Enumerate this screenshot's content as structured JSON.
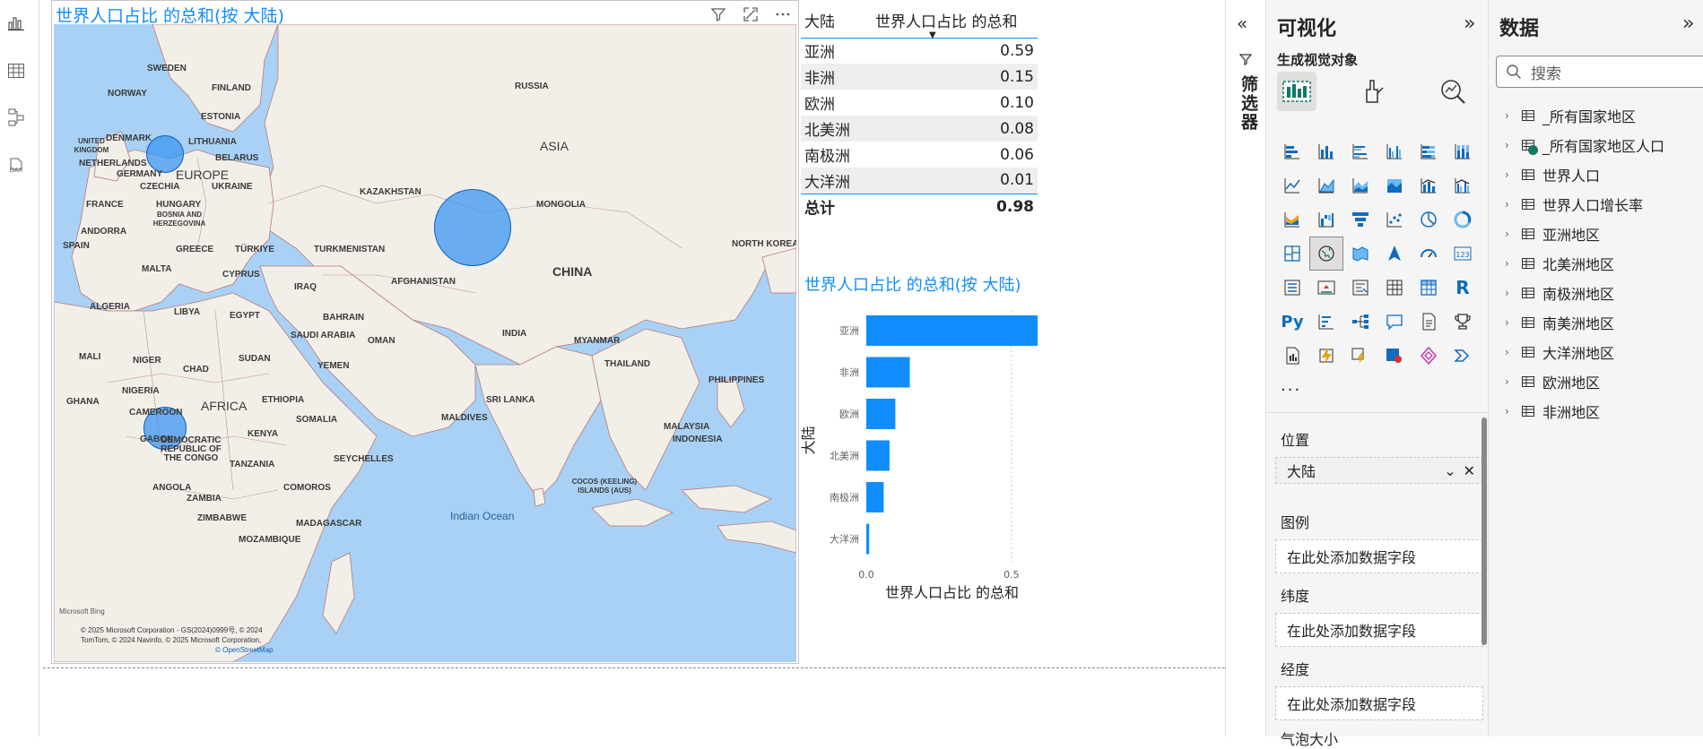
{
  "left_rail": {
    "items": [
      {
        "icon": "report-view-icon"
      },
      {
        "icon": "table-view-icon"
      },
      {
        "icon": "model-view-icon"
      },
      {
        "icon": "dax-query-icon",
        "label": "DAX"
      }
    ]
  },
  "map": {
    "title": "世界人口占比 的总和(按 大陆)",
    "labels": {
      "sweden": "SWEDEN",
      "finland": "FINLAND",
      "norway": "NORWAY",
      "russia": "RUSSIA",
      "estonia": "ESTONIA",
      "denmark": "DENMARK",
      "lithuania": "LITHUANIA",
      "uk": "UNITED KINGDOM",
      "belarus": "BELARUS",
      "netherlands": "NETHERLANDS",
      "germany": "GERMANY",
      "europe": "EUROPE",
      "czechia": "CZECHIA",
      "ukraine": "UKRAINE",
      "asia": "ASIA",
      "kazakhstan": "KAZAKHSTAN",
      "mongolia": "MONGOLIA",
      "france": "FRANCE",
      "hungary": "HUNGARY",
      "bosnia": "BOSNIA AND HERZEGOVINA",
      "andorra": "ANDORRA",
      "spain": "SPAIN",
      "greece": "GREECE",
      "turkiye": "TÜRKIYE",
      "turkmenistan": "TURKMENISTAN",
      "north_korea": "NORTH KOREA",
      "malta": "MALTA",
      "cyprus": "CYPRUS",
      "china": "CHINA",
      "afghanistan": "AFGHANISTAN",
      "iraq": "IRAQ",
      "algeria": "ALGERIA",
      "libya": "LIBYA",
      "egypt": "EGYPT",
      "bahrain": "BAHRAIN",
      "saudi_arabia": "SAUDI ARABIA",
      "oman": "OMAN",
      "india": "INDIA",
      "myanmar": "MYANMAR",
      "mali": "MALI",
      "niger": "NIGER",
      "sudan": "SUDAN",
      "yemen": "YEMEN",
      "thailand": "THAILAND",
      "chad": "CHAD",
      "philippines": "PHILIPPINES",
      "nigeria": "NIGERIA",
      "ethiopia": "ETHIOPIA",
      "sri_lanka": "SRI LANKA",
      "ghana": "GHANA",
      "africa": "AFRICA",
      "cameroon": "CAMEROON",
      "maldives": "MALDIVES",
      "somalia": "SOMALIA",
      "malaysia": "MALAYSIA",
      "gabon": "GABON",
      "drc": "DEMOCRATIC REPUBLIC OF THE CONGO",
      "kenya": "KENYA",
      "indonesia": "INDONESIA",
      "seychelles": "SEYCHELLES",
      "tanzania": "TANZANIA",
      "angola": "ANGOLA",
      "comoros": "COMOROS",
      "cocos": "COCOS (KEELING) ISLANDS (AUS)",
      "zambia": "ZAMBIA",
      "zimbabwe": "ZIMBABWE",
      "madagascar": "MADAGASCAR",
      "indian_ocean": "Indian Ocean",
      "mozambique": "MOZAMBIQUE"
    },
    "bing": "Microsoft Bing",
    "copyright_1": "© 2025 Microsoft Corporation - GS(2024)0999号, © 2024",
    "copyright_2": "TomTom, © 2024 Navinfo, © 2025 Microsoft Corporation,",
    "copyright_3": "© OpenStreetMap"
  },
  "table": {
    "col1": "大陆",
    "col2": "世界人口占比 的总和",
    "rows": [
      {
        "name": "亚洲",
        "value": "0.59"
      },
      {
        "name": "非洲",
        "value": "0.15"
      },
      {
        "name": "欧洲",
        "value": "0.10"
      },
      {
        "name": "北美洲",
        "value": "0.08"
      },
      {
        "name": "南极洲",
        "value": "0.06"
      },
      {
        "name": "大洋洲",
        "value": "0.01"
      }
    ],
    "total_label": "总计",
    "total_value": "0.98"
  },
  "chart_data": {
    "type": "bar",
    "orientation": "horizontal",
    "title": "世界人口占比 的总和(按 大陆)",
    "categories": [
      "亚洲",
      "非洲",
      "欧洲",
      "北美洲",
      "南极洲",
      "大洋洲"
    ],
    "values": [
      0.59,
      0.15,
      0.1,
      0.08,
      0.06,
      0.01
    ],
    "xlabel": "世界人口占比 的总和",
    "ylabel": "大陆",
    "xticks": [
      "0.0",
      "0.5"
    ],
    "xlim": [
      0,
      0.59
    ],
    "color": "#118dff",
    "grid": true
  },
  "filter_pane": {
    "label": "筛选器"
  },
  "viz_pane": {
    "title": "可视化",
    "build_label": "生成视觉对象",
    "more": "...",
    "fields": [
      {
        "label": "位置",
        "value": "大陆"
      },
      {
        "label": "图例",
        "placeholder": "在此处添加数据字段"
      },
      {
        "label": "纬度",
        "placeholder": "在此处添加数据字段"
      },
      {
        "label": "经度",
        "placeholder": "在此处添加数据字段"
      }
    ],
    "cut_label": "气泡大小"
  },
  "data_pane": {
    "title": "数据",
    "search_placeholder": "搜索",
    "tables": [
      "_所有国家地区",
      "_所有国家地区人口",
      "世界人口",
      "世界人口增长率",
      "亚洲地区",
      "北美洲地区",
      "南极洲地区",
      "南美洲地区",
      "大洋洲地区",
      "欧洲地区",
      "非洲地区"
    ]
  },
  "colors": {
    "accent": "#118dff",
    "bubble": "#60adf5",
    "ocean": "#a9d1f5",
    "land": "#f2efe9"
  }
}
